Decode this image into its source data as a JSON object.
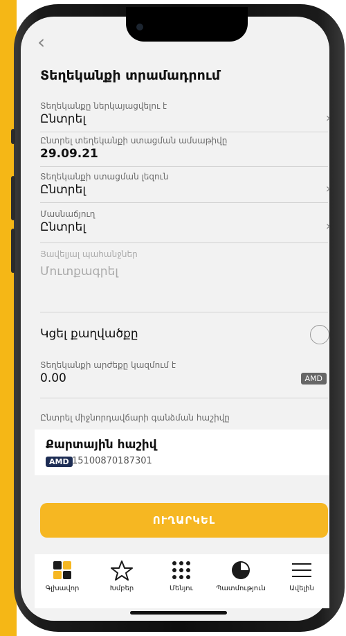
{
  "screen": {
    "title": "Տեղեկանքի տրամադրում",
    "back_icon": "‹"
  },
  "fields": [
    {
      "label": "Տեղեկանքը ներկայացվելու է",
      "value": "Ընտրել",
      "has_chevron": true
    },
    {
      "label": "Ընտրել տեղեկանքի ստացման ամսաթիվը",
      "value": "29.09.21",
      "has_chevron": false
    },
    {
      "label": "Տեղեկանքի ստացման լեզուն",
      "value": "Ընտրել",
      "has_chevron": true
    },
    {
      "label": "Մասնաճյուղ",
      "value": "Ընտրել",
      "has_chevron": true
    }
  ],
  "requirements": {
    "label": "Յավելյալ պահանջներ",
    "placeholder": "Մուտքագրել"
  },
  "sealed_toggle": {
    "label": "Կցել քաղվածքը"
  },
  "amount": {
    "label": "Տեղեկանքի արժեքը կազմում է",
    "value": "0.00",
    "currency": "AMD"
  },
  "account_section": {
    "label": "Ընտրել միջնորդավճարի գանձման հաշիվը",
    "account_name": "Քարտային հաշիվ",
    "currency": "AMD",
    "number": "15100870187301"
  },
  "send_button": {
    "label": "ՈՒՂԱՐԿԵԼ"
  },
  "tabs": [
    {
      "label": "Գլխավոր",
      "icon": "home-grid-icon"
    },
    {
      "label": "Խմբեր",
      "icon": "star-icon"
    },
    {
      "label": "Մենյու",
      "icon": "dots-grid-icon"
    },
    {
      "label": "Պատմություն",
      "icon": "clock-pie-icon"
    },
    {
      "label": "Ավելին",
      "icon": "hamburger-icon"
    }
  ],
  "colors": {
    "accent": "#f6b722",
    "badge": "#1d2d54"
  }
}
